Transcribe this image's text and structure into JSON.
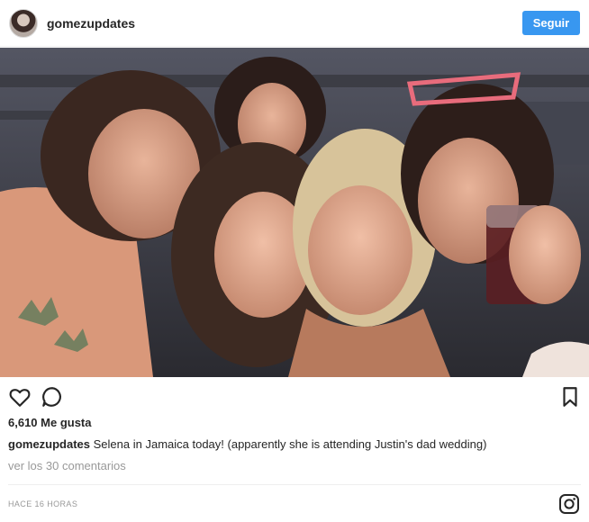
{
  "header": {
    "username": "gomezupdates",
    "follow_label": "Seguir"
  },
  "photo": {
    "alt": "Group selfie of five women"
  },
  "actions": {
    "like_icon": "heart-icon",
    "comment_icon": "comment-icon",
    "save_icon": "bookmark-icon"
  },
  "stats": {
    "likes_text": "6,610 Me gusta"
  },
  "caption": {
    "username": "gomezupdates",
    "text": "Selena in Jamaica today! (apparently she is attending Justin's dad wedding)"
  },
  "comments": {
    "view_label": "ver los 30 comentarios"
  },
  "footer": {
    "timestamp": "HACE 16 HORAS",
    "logo_icon": "instagram-icon"
  },
  "colors": {
    "follow_button": "#3897f0",
    "muted_text": "#999999"
  }
}
